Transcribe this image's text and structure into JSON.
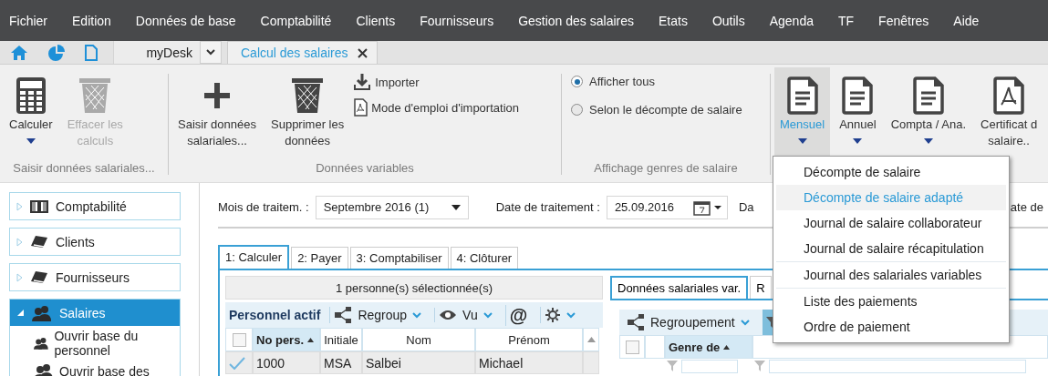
{
  "menubar": {
    "items": [
      "Fichier",
      "Edition",
      "Données de base",
      "Comptabilité",
      "Clients",
      "Fournisseurs",
      "Gestion des salaires",
      "Etats",
      "Outils",
      "Agenda",
      "TF",
      "Fenêtres",
      "Aide"
    ]
  },
  "tabbar": {
    "desk": "myDesk",
    "tabs": [
      {
        "label": "Calcul des salaires",
        "selected": true
      }
    ]
  },
  "ribbon": {
    "groups": [
      {
        "label": "Saisir données salariales...",
        "items": [
          {
            "kind": "large",
            "label": "Calculer",
            "disabled": false,
            "dropdown": true
          },
          {
            "kind": "large",
            "label": "Effacer les\ncalculs",
            "disabled": true,
            "dropdown": false
          }
        ]
      },
      {
        "label": "Données variables",
        "items": [
          {
            "kind": "large",
            "label": "Saisir données\nsalariales...",
            "disabled": false,
            "dropdown": false
          },
          {
            "kind": "large",
            "label": "Supprimer les\ndonnées",
            "disabled": false,
            "dropdown": false
          },
          {
            "kind": "small",
            "label": "Importer"
          },
          {
            "kind": "small",
            "label": "Mode d'emploi d'importation"
          }
        ]
      },
      {
        "label": "Affichage genres de salaire",
        "items": [
          {
            "kind": "radio",
            "label": "Afficher tous",
            "selected": true
          },
          {
            "kind": "radio",
            "label": "Selon le décompte de salaire",
            "selected": false
          }
        ]
      },
      {
        "items": [
          {
            "kind": "large",
            "label": "Mensuel",
            "selected": true,
            "dropdown": true
          },
          {
            "kind": "large",
            "label": "Annuel",
            "selected": false,
            "dropdown": true
          },
          {
            "kind": "large",
            "label": "Compta / Ana.",
            "selected": false,
            "dropdown": true
          },
          {
            "kind": "large",
            "label": "Certificat d\nsalaire..",
            "selected": false,
            "dropdown": false
          }
        ]
      }
    ]
  },
  "sidebar": {
    "items": [
      {
        "label": "Comptabilité",
        "expanded": false,
        "selected": false
      },
      {
        "label": "Clients",
        "expanded": false,
        "selected": false
      },
      {
        "label": "Fournisseurs",
        "expanded": false,
        "selected": false
      },
      {
        "label": "Salaires",
        "expanded": true,
        "selected": true,
        "children": [
          {
            "label": "Ouvrir base du personnel"
          },
          {
            "label": "Ouvrir base des"
          }
        ]
      }
    ]
  },
  "filters": [
    {
      "kind": "select",
      "label": "Mois de traitem. :",
      "value": "Septembre 2016 (1)"
    },
    {
      "kind": "date",
      "label": "Date de traitement :",
      "value": "25.09.2016"
    },
    {
      "kind": "label",
      "label": "Da"
    },
    {
      "kind": "label",
      "label": "ate de"
    }
  ],
  "steps": [
    {
      "label": "1: Calculer",
      "selected": true
    },
    {
      "label": "2: Payer",
      "selected": false
    },
    {
      "label": "3: Comptabiliser",
      "selected": false
    },
    {
      "label": "4: Clôturer",
      "selected": false
    }
  ],
  "personnel": {
    "select_all": {
      "checked": false
    },
    "header": "1 personne(s) sélectionnée(s)",
    "title": "Personnel actif",
    "toolbar": [
      "Regroup",
      "Vu",
      "@"
    ],
    "columns": [
      {
        "label": "No pers.",
        "sorted": true
      },
      {
        "label": "Initiale",
        "sorted": false
      },
      {
        "label": "Nom",
        "sorted": false
      },
      {
        "label": "Prénom",
        "sorted": false
      }
    ],
    "rows": [
      {
        "checked": true,
        "cells": [
          "1000",
          "MSA",
          "Salbei",
          "Michael"
        ]
      }
    ]
  },
  "variables": {
    "select_all": {
      "checked": false
    },
    "tabs": [
      {
        "label": "Données salariales var.",
        "selected": true
      },
      {
        "label": "R",
        "selected": false
      }
    ],
    "toolbar": [
      "Regroupement"
    ],
    "columns": [
      {
        "label": "Genre de",
        "sorted": true
      }
    ]
  },
  "menu": {
    "groups": [
      {
        "items": [
          {
            "label": "Décompte de salaire",
            "selected": false
          },
          {
            "label": "Décompte de salaire adapté",
            "selected": true
          },
          {
            "label": "Journal de salaire collaborateur",
            "selected": false
          },
          {
            "label": "Journal de salaire récapitulation",
            "selected": false
          }
        ]
      },
      {
        "items": [
          {
            "label": "Journal des salariales variables",
            "selected": false
          }
        ]
      },
      {
        "items": [
          {
            "label": "Liste des paiements",
            "selected": false
          },
          {
            "label": "Ordre de paiement",
            "selected": false
          }
        ]
      }
    ]
  }
}
